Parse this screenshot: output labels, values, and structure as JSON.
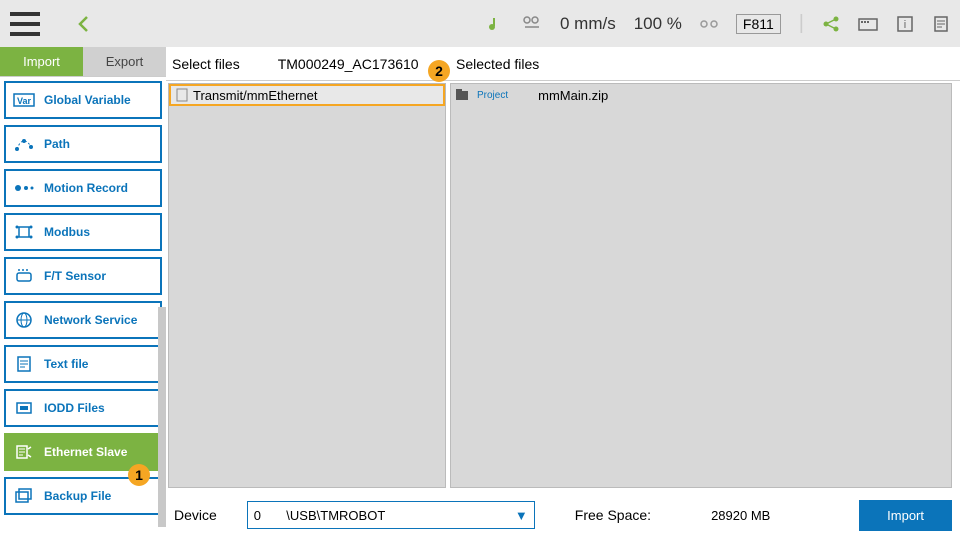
{
  "topbar": {
    "speed": "0 mm/s",
    "percent": "100 %",
    "code": "F811"
  },
  "tabs": {
    "import": "Import",
    "export": "Export"
  },
  "sidebar": {
    "items": [
      {
        "label": "Global Variable"
      },
      {
        "label": "Path"
      },
      {
        "label": "Motion Record"
      },
      {
        "label": "Modbus"
      },
      {
        "label": "F/T Sensor"
      },
      {
        "label": "Network Service"
      },
      {
        "label": "Text file"
      },
      {
        "label": "IODD Files"
      },
      {
        "label": "Ethernet Slave"
      },
      {
        "label": "Backup File"
      }
    ]
  },
  "header": {
    "select_files": "Select files",
    "device_id": "TM000249_AC173610",
    "selected_files": "Selected files"
  },
  "left_list": {
    "item0": "Transmit/mmEthernet"
  },
  "right_list": {
    "project_label": "Project",
    "item0": "mmMain.zip"
  },
  "footer": {
    "device_label": "Device",
    "device_value": "0       \\USB\\TMROBOT",
    "free_space_label": "Free Space:",
    "free_space_value": "28920 MB",
    "import_btn": "Import"
  },
  "badges": {
    "b1": "1",
    "b2": "2"
  }
}
